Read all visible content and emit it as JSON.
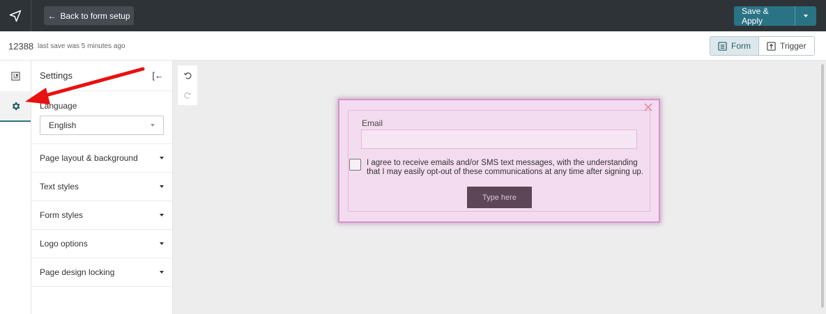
{
  "topbar": {
    "back_label": "Back to form setup",
    "save_label": "Save & Apply"
  },
  "subbar": {
    "form_id": "12388",
    "last_save": "last save was 5 minutes ago",
    "tabs": [
      {
        "label": "Form",
        "icon": "form-icon",
        "active": true
      },
      {
        "label": "Trigger",
        "icon": "trigger-icon",
        "active": false
      }
    ]
  },
  "rail": {
    "items": [
      {
        "icon": "layout-icon",
        "active": false
      },
      {
        "icon": "gear-icon",
        "active": true
      }
    ]
  },
  "settings": {
    "title": "Settings",
    "language_label": "Language",
    "language_value": "English",
    "sections": [
      {
        "label": "Page layout & background"
      },
      {
        "label": "Text styles"
      },
      {
        "label": "Form styles"
      },
      {
        "label": "Logo options"
      },
      {
        "label": "Page design locking"
      }
    ]
  },
  "popup": {
    "email_label": "Email",
    "consent_text": "I agree to receive emails and/or SMS text messages, with the understanding that I may easily opt-out of these communications at any time after signing up.",
    "submit_label": "Type here"
  },
  "colors": {
    "topbar": "#2e3338",
    "accent": "#2a7384",
    "popup_bg": "#f3dcef",
    "popup_border": "#d98fcf",
    "annotation_arrow": "#e81010"
  }
}
